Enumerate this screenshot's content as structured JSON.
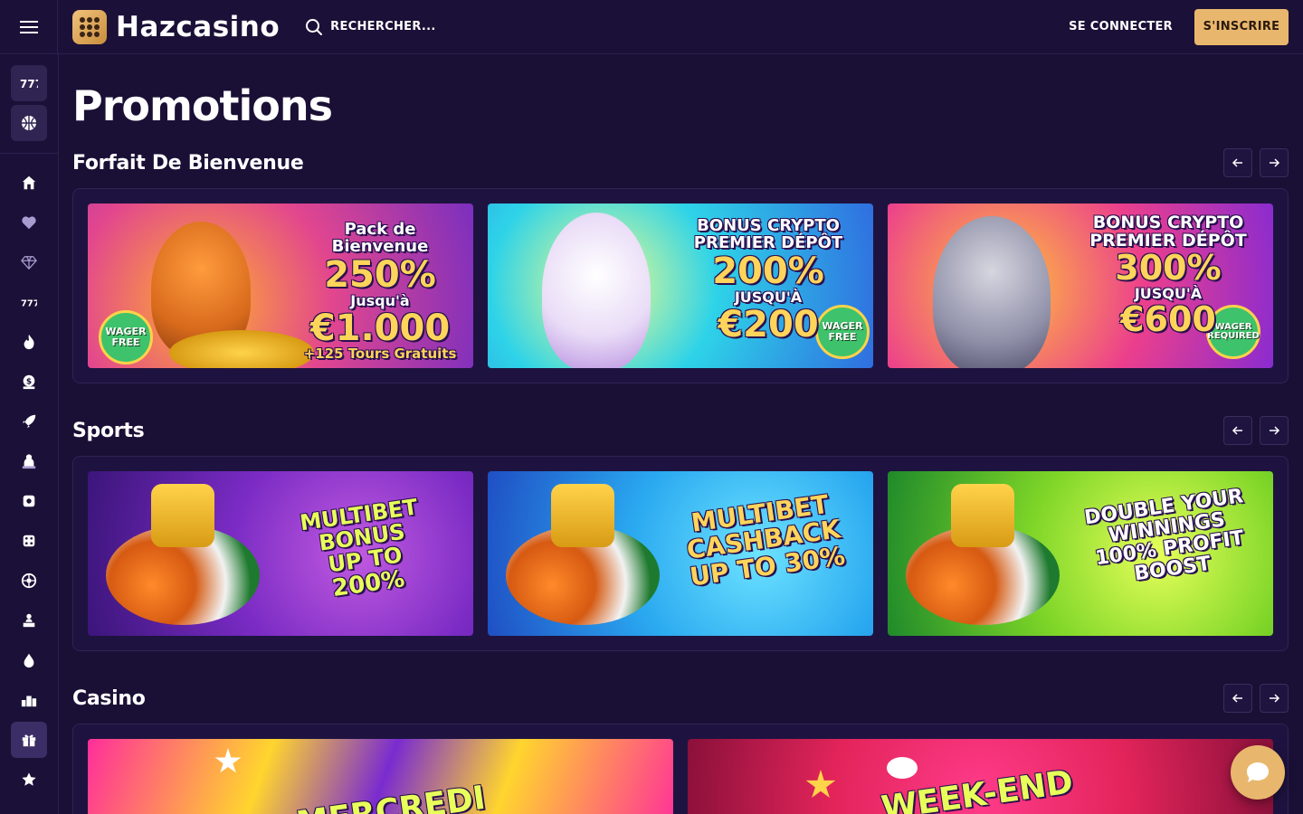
{
  "header": {
    "brand": "Hazcasino",
    "search_label": "RECHERCHER...",
    "login_label": "SE CONNECTER",
    "signup_label": "S'INSCRIRE"
  },
  "sidebar": {
    "top_items": [
      "slots-icon",
      "basketball-icon"
    ],
    "items": [
      "home-icon",
      "heart-icon",
      "diamond-icon",
      "slots-icon",
      "fire-icon",
      "money-bag-icon",
      "rocket-icon",
      "dealer-icon",
      "gamepad-icon",
      "dice-icon",
      "roulette-icon",
      "podium-person-icon",
      "drop-icon",
      "leaderboard-icon",
      "gift-icon",
      "star-icon"
    ],
    "active_item": "gift-icon"
  },
  "page": {
    "title": "Promotions"
  },
  "sections": {
    "welcome": {
      "title": "Forfait De Bienvenue",
      "cards": [
        {
          "lines": [
            "Pack de Bienvenue",
            "250%",
            "Jusqu'à",
            "€1.000",
            "+125 Tours Gratuits"
          ],
          "badge": "WAGER FREE"
        },
        {
          "lines": [
            "BONUS CRYPTO",
            "PREMIER DÉPÔT",
            "200%",
            "JUSQU'À",
            "€200"
          ],
          "badge": "WAGER FREE"
        },
        {
          "lines": [
            "BONUS CRYPTO",
            "PREMIER DÉPÔT",
            "300%",
            "JUSQU'À",
            "€600"
          ],
          "badge": "WAGER REQUIRED"
        }
      ]
    },
    "sports": {
      "title": "Sports",
      "cards": [
        {
          "lines": [
            "MULTIBET BONUS",
            "UP TO",
            "200%"
          ]
        },
        {
          "lines": [
            "MULTIBET",
            "CASHBACK",
            "UP TO 30%"
          ]
        },
        {
          "lines": [
            "DOUBLE YOUR",
            "WINNINGS",
            "100% PROFIT",
            "BOOST"
          ]
        }
      ]
    },
    "casino": {
      "title": "Casino",
      "cards": [
        {
          "lines": [
            "MERCREDI"
          ]
        },
        {
          "lines": [
            "WEEK-END"
          ]
        }
      ]
    }
  },
  "colors": {
    "background": "#1a0f35",
    "accent": "#e8b76d",
    "panel": "#1e1340"
  }
}
